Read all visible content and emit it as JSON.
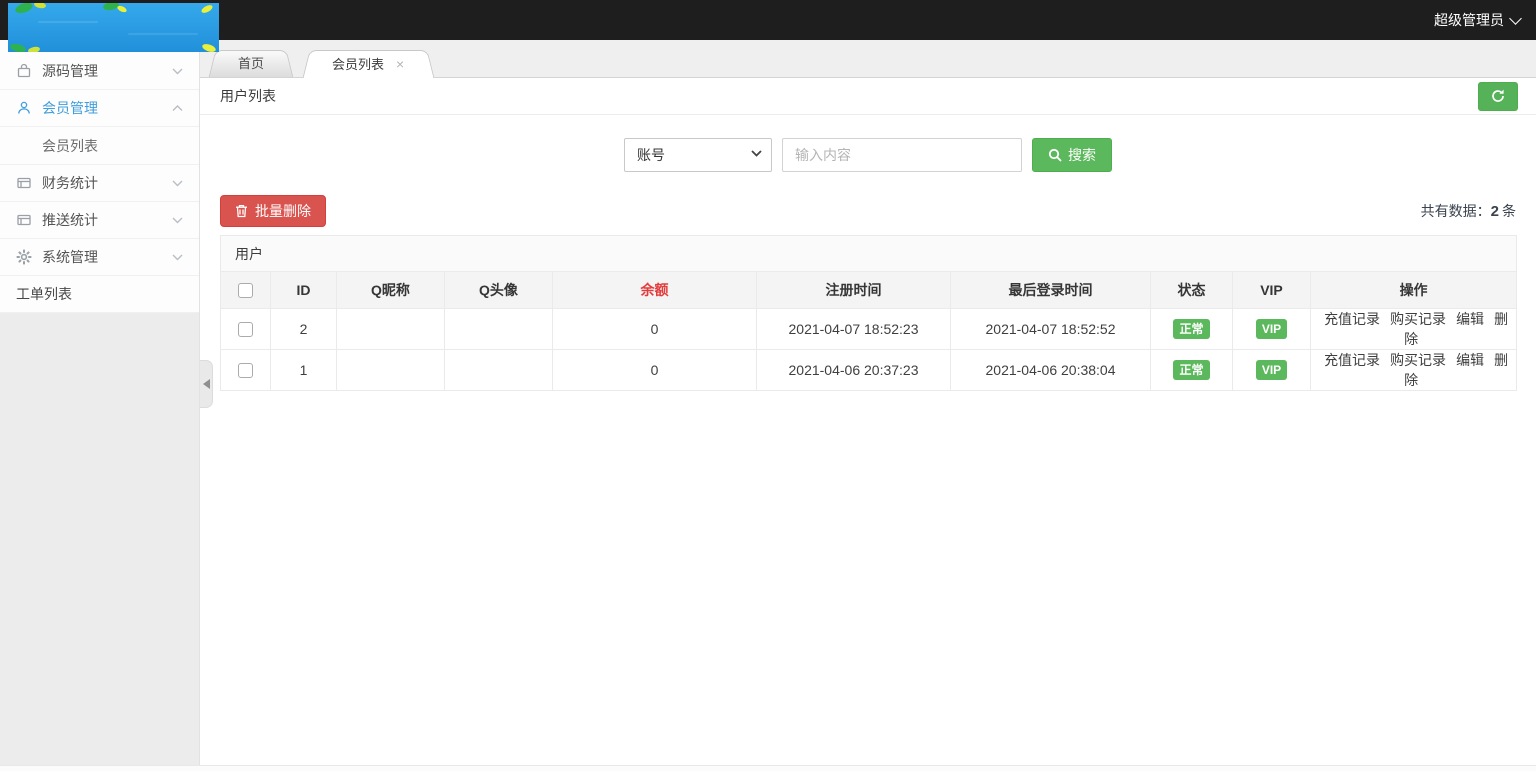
{
  "topbar": {
    "user_label": "超级管理员"
  },
  "sidebar": {
    "items": [
      {
        "label": "源码管理",
        "icon": "bag-icon",
        "state": "collapsed"
      },
      {
        "label": "会员管理",
        "icon": "user-icon",
        "state": "expanded",
        "active": true,
        "children": [
          {
            "label": "会员列表"
          }
        ]
      },
      {
        "label": "财务统计",
        "icon": "ledger-icon",
        "state": "collapsed"
      },
      {
        "label": "推送统计",
        "icon": "ledger-icon",
        "state": "collapsed"
      },
      {
        "label": "系统管理",
        "icon": "gear-icon",
        "state": "collapsed"
      },
      {
        "label": "工单列表"
      }
    ]
  },
  "tabs": [
    {
      "label": "首页",
      "active": false
    },
    {
      "label": "会员列表",
      "active": true,
      "closable": true
    }
  ],
  "page": {
    "title": "用户列表"
  },
  "search": {
    "field_selected": "账号",
    "input_placeholder": "输入内容",
    "button_label": "搜索"
  },
  "toolbar": {
    "batch_delete_label": "批量删除",
    "total_prefix": "共有数据：",
    "total_count": "2",
    "total_suffix": "条"
  },
  "table": {
    "group_header": "用户",
    "columns": [
      "ID",
      "Q昵称",
      "Q头像",
      "余额",
      "注册时间",
      "最后登录时间",
      "状态",
      "VIP",
      "操作"
    ],
    "rows": [
      {
        "id": "2",
        "q_nickname": "",
        "q_avatar": "",
        "balance": "0",
        "register_time": "2021-04-07 18:52:23",
        "last_login_time": "2021-04-07 18:52:52",
        "status": "正常",
        "vip": "VIP",
        "actions": [
          "充值记录",
          "购买记录",
          "编辑",
          "删除"
        ]
      },
      {
        "id": "1",
        "q_nickname": "",
        "q_avatar": "",
        "balance": "0",
        "register_time": "2021-04-06 20:37:23",
        "last_login_time": "2021-04-06 20:38:04",
        "status": "正常",
        "vip": "VIP",
        "actions": [
          "充值记录",
          "购买记录",
          "编辑",
          "删除"
        ]
      }
    ]
  },
  "colors": {
    "topbar_bg": "#1e1e1e",
    "logo_blue": "#2aa2e8",
    "active_menu_blue": "#3f9edb",
    "accent_green": "#5cb85c",
    "danger_red": "#d9534f",
    "balance_header_red": "#e23c3c"
  }
}
